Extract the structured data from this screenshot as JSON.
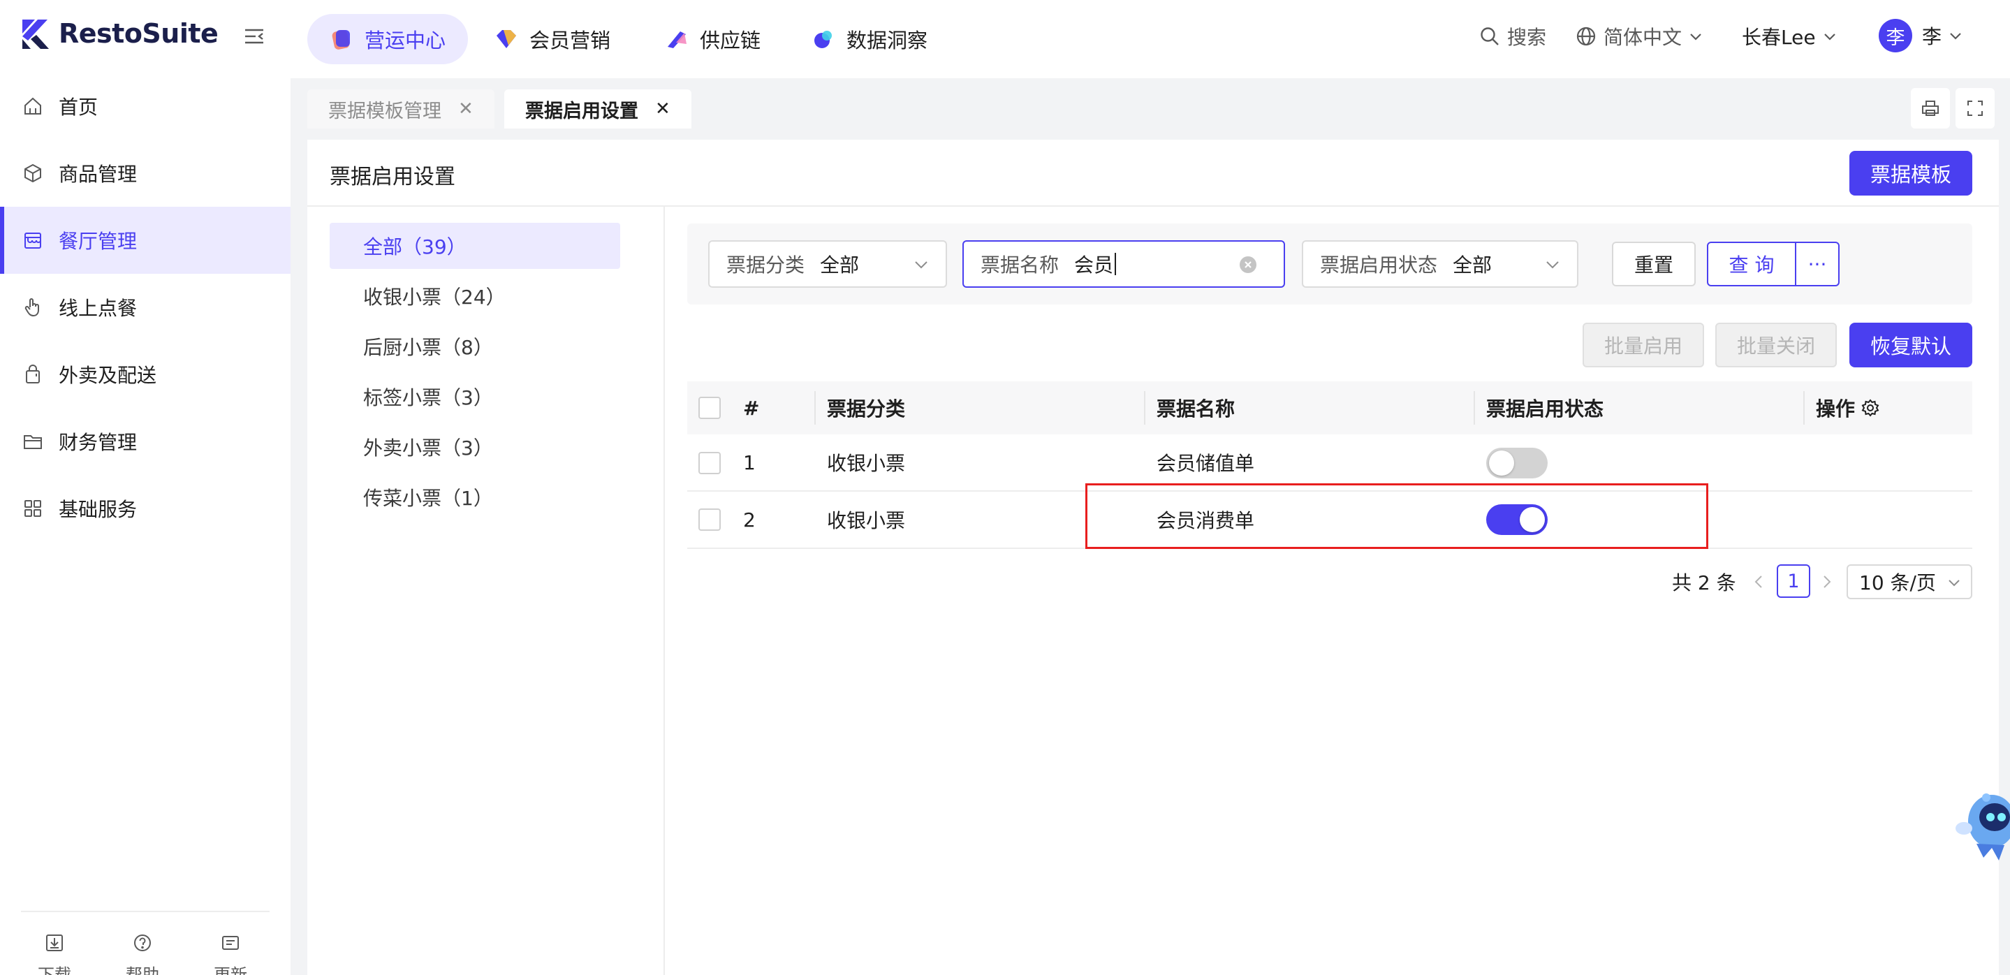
{
  "app": {
    "logo": "RestoSuite"
  },
  "topnav": [
    {
      "label": "营运中心",
      "active": true
    },
    {
      "label": "会员营销",
      "active": false
    },
    {
      "label": "供应链",
      "active": false
    },
    {
      "label": "数据洞察",
      "active": false
    }
  ],
  "header_right": {
    "search": "搜索",
    "language": "简体中文",
    "store": "长春Lee",
    "avatar_char": "李",
    "user": "李"
  },
  "sidebar": {
    "items": [
      {
        "label": "首页",
        "icon": "home-icon"
      },
      {
        "label": "商品管理",
        "icon": "box-icon"
      },
      {
        "label": "餐厅管理",
        "icon": "store-icon",
        "active": true
      },
      {
        "label": "线上点餐",
        "icon": "hand-icon"
      },
      {
        "label": "外卖及配送",
        "icon": "bag-icon"
      },
      {
        "label": "财务管理",
        "icon": "folder-icon"
      },
      {
        "label": "基础服务",
        "icon": "grid-icon"
      }
    ],
    "footer": [
      {
        "label": "下载",
        "icon": "download-icon"
      },
      {
        "label": "帮助",
        "icon": "help-icon"
      },
      {
        "label": "更新",
        "icon": "news-icon"
      }
    ]
  },
  "tabs": [
    {
      "label": "票据模板管理",
      "active": false
    },
    {
      "label": "票据启用设置",
      "active": true
    }
  ],
  "page": {
    "title": "票据启用设置",
    "template_button": "票据模板"
  },
  "categories": [
    {
      "label": "全部（39）",
      "active": true
    },
    {
      "label": "收银小票（24）"
    },
    {
      "label": "后厨小票（8）"
    },
    {
      "label": "标签小票（3）"
    },
    {
      "label": "外卖小票（3）"
    },
    {
      "label": "传菜小票（1）"
    }
  ],
  "filters": {
    "category": {
      "label": "票据分类",
      "value": "全部"
    },
    "name": {
      "label": "票据名称",
      "value": "会员"
    },
    "status": {
      "label": "票据启用状态",
      "value": "全部"
    },
    "reset": "重置",
    "query": "查 询",
    "more": "···"
  },
  "actions": {
    "batch_enable": "批量启用",
    "batch_disable": "批量关闭",
    "restore": "恢复默认"
  },
  "table": {
    "headers": [
      "#",
      "票据分类",
      "票据名称",
      "票据启用状态",
      "操作"
    ],
    "rows": [
      {
        "num": "1",
        "category": "收银小票",
        "name": "会员储值单",
        "enabled": false
      },
      {
        "num": "2",
        "category": "收银小票",
        "name": "会员消费单",
        "enabled": true
      }
    ]
  },
  "pagination": {
    "total": "共 2 条",
    "current": "1",
    "size": "10 条/页"
  }
}
